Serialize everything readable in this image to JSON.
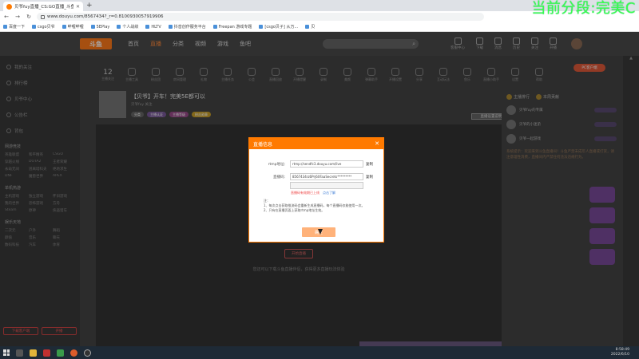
{
  "browser": {
    "tab_title": "贝爷fuy直播_CS:GO直播_斗鱼直",
    "url": "www.douyu.com/8567434?_r=0.8100930057919906",
    "bookmarks": [
      "百度一下",
      "csgo贝爷",
      "哔哩哔哩",
      "5EPlay",
      "个人战绩",
      "HLTV",
      "抖音创作服务平台",
      "Freepan 游戏专题",
      "[csgo贝子] 从万...",
      "贝"
    ]
  },
  "overlay": {
    "text": "当前分段:完美C"
  },
  "site": {
    "logo": "斗鱼",
    "nav": [
      "首页",
      "直播",
      "分类",
      "视频",
      "游戏",
      "鱼吧"
    ],
    "header_icons": [
      "客服中心",
      "下载",
      "消息",
      "历史",
      "关注",
      "开播"
    ],
    "follow_count": "12",
    "follow_label": "主播关注",
    "tools": [
      "主播工具",
      "粉丝团",
      "房间管理",
      "礼物",
      "主播任务",
      "公会",
      "直播回放",
      "开播提醒",
      "录制",
      "美颜",
      "弹幕助手",
      "开播设置",
      "分享",
      "互动玩法",
      "鱼乐",
      "直播小助手",
      "设置",
      "帮助",
      "帮助中心",
      "更多"
    ],
    "pc_button": "PC客户端"
  },
  "room": {
    "title": "【贝爷】开车！完美5E都可以",
    "sub": "贝爷fuy  关注",
    "tags": [
      "分类",
      "主播认证",
      "主播等级",
      "粉丝勋章"
    ],
    "settings": "直播设置说明"
  },
  "sidebar": {
    "items": [
      "我的关注",
      "排行榜",
      "贝爷中心",
      "公告栏",
      "背包"
    ],
    "section1": "网游竞技",
    "grid1": [
      "英雄联盟",
      "和平精英",
      "CSGO",
      "穿越火线",
      "DOTA2",
      "王者荣耀",
      "永劫无间",
      "逃离塔科夫",
      "绝地求生",
      "DNF",
      "魔兽世界",
      "APEX"
    ],
    "section2": "单机热游",
    "grid2": [
      "主机游戏",
      "独立游戏",
      "怀旧游戏",
      "我的世界",
      "恐怖游戏",
      "方舟",
      "Steam",
      "原神",
      "侠盗猎车"
    ],
    "section3": "娱乐天地",
    "grid3": [
      "二次元",
      "户外",
      "舞蹈",
      "颜值",
      "音乐",
      "聊天",
      "数码科技",
      "汽车",
      "体育"
    ],
    "btn_left": "下载客户端",
    "btn_right": "开播"
  },
  "video": {
    "start_button": "开始直播",
    "hint": "您还可以下载斗鱼直播伴侣，获得更多直播玩法体验"
  },
  "rightpanel": {
    "tabs": [
      "主播排行",
      "本周贡献"
    ],
    "users": [
      "贝爷fuy的专属",
      "贝爷的小迷弟",
      "贝爷一起游戏"
    ],
    "notice": "系统提示：欢迎来到斗鱼直播间！斗鱼严禁未成年人直播或打赏，请注意理性消费，直播间内严禁任何违法违规行为。"
  },
  "modal": {
    "title": "直播信息",
    "rtmp_label": "rtmp地址：",
    "rtmp_value": "rtmp://sendfc3.douyu.com/live",
    "key_label": "直播码：",
    "key_value": "8567434rz6Prj6XFaaSecrets*********",
    "copy": "复制",
    "warning": "直播码有效期已上线",
    "learn_more": "点击了解",
    "note_title": "注：",
    "notes": [
      "1、每次点击获取推流码会重新生成直播码，每个直播码仅能使用一次。",
      "2、只有在直播页面上获取rtmp地址生效。"
    ],
    "confirm": "确定"
  },
  "taskbar": {
    "time": "8:58:49",
    "date": "2022/6/10"
  },
  "colors": {
    "accent": "#ff7a00",
    "overlay": "#39ff4d"
  }
}
